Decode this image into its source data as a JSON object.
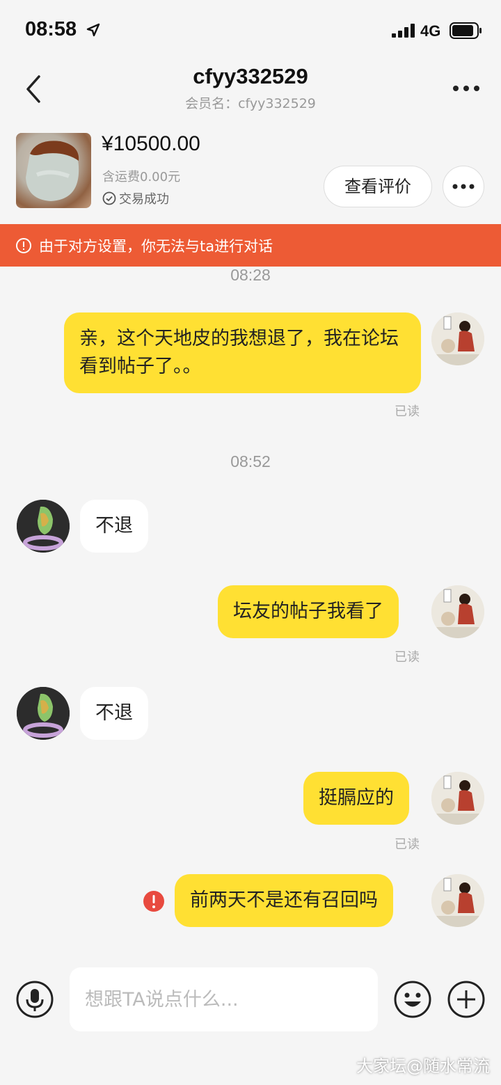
{
  "status_bar": {
    "time": "08:58",
    "network": "4G"
  },
  "header": {
    "title": "cfyy332529",
    "subtitle": "会员名：cfyy332529"
  },
  "product": {
    "price": "¥10500.00",
    "shipping": "含运费0.00元",
    "trade_status": "交易成功",
    "review_button": "查看评价"
  },
  "notice": {
    "text": "由于对方设置，你无法与ta进行对话"
  },
  "messages": {
    "ts1": "08:28",
    "m1": "亲，这个天地皮的我想退了，我在论坛看到帖子了。。",
    "read1": "已读",
    "ts2": "08:52",
    "m2": "不退",
    "m3": "坛友的帖子我看了",
    "read3": "已读",
    "m4": "不退",
    "m5": "挺膈应的",
    "read5": "已读",
    "m6": "前两天不是还有召回吗"
  },
  "input": {
    "placeholder": "想跟TA说点什么..."
  },
  "watermark": "大家坛@随水常流",
  "colors": {
    "accent": "#ffe033",
    "notice": "#ed5b35",
    "error": "#e84a3f"
  },
  "icons": [
    "location-icon",
    "signal-icon",
    "battery-icon",
    "back-icon",
    "more-icon",
    "check-circle-icon",
    "alert-circle-icon",
    "error-icon",
    "mic-icon",
    "emoji-icon",
    "plus-icon"
  ]
}
